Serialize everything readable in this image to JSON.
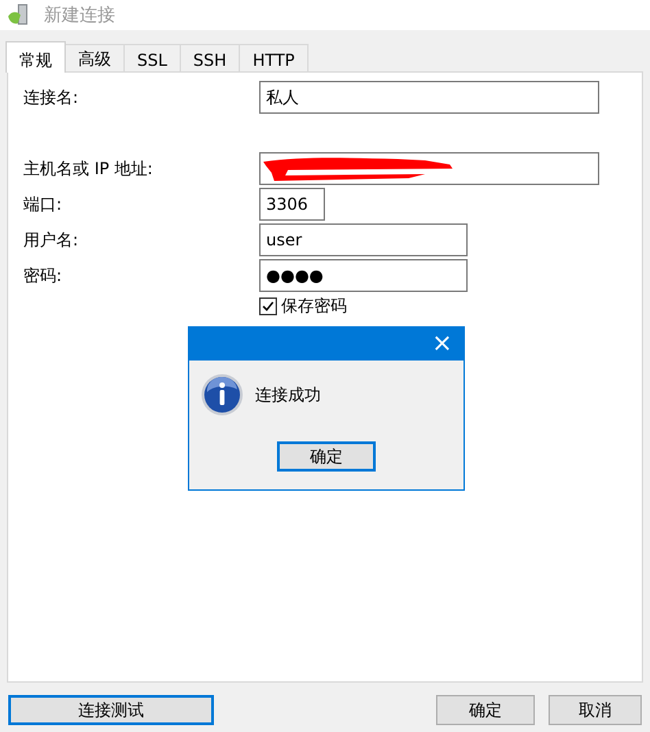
{
  "window": {
    "title": "新建连接"
  },
  "tabs": [
    {
      "label": "常规",
      "selected": true
    },
    {
      "label": "高级",
      "selected": false
    },
    {
      "label": "SSL",
      "selected": false
    },
    {
      "label": "SSH",
      "selected": false
    },
    {
      "label": "HTTP",
      "selected": false
    }
  ],
  "fields": [
    {
      "kind": "text",
      "label": "连接名:",
      "value": "私人"
    },
    {
      "kind": "redacted",
      "label": "主机名或 IP 地址:"
    },
    {
      "kind": "text",
      "label": "端口:",
      "value": "3306"
    },
    {
      "kind": "text",
      "label": "用户名:",
      "value": "user"
    },
    {
      "kind": "text",
      "label": "密码:",
      "value": "●●●●"
    }
  ],
  "save_password": {
    "label": "保存密码",
    "checked": true
  },
  "message_box": {
    "close": "×",
    "message": "连接成功",
    "button": {
      "label": "确定",
      "default": true
    }
  },
  "buttons": [
    {
      "label": "连接测试",
      "default": true
    },
    {
      "label": "确定",
      "default": false
    },
    {
      "label": "取消",
      "default": false
    }
  ]
}
